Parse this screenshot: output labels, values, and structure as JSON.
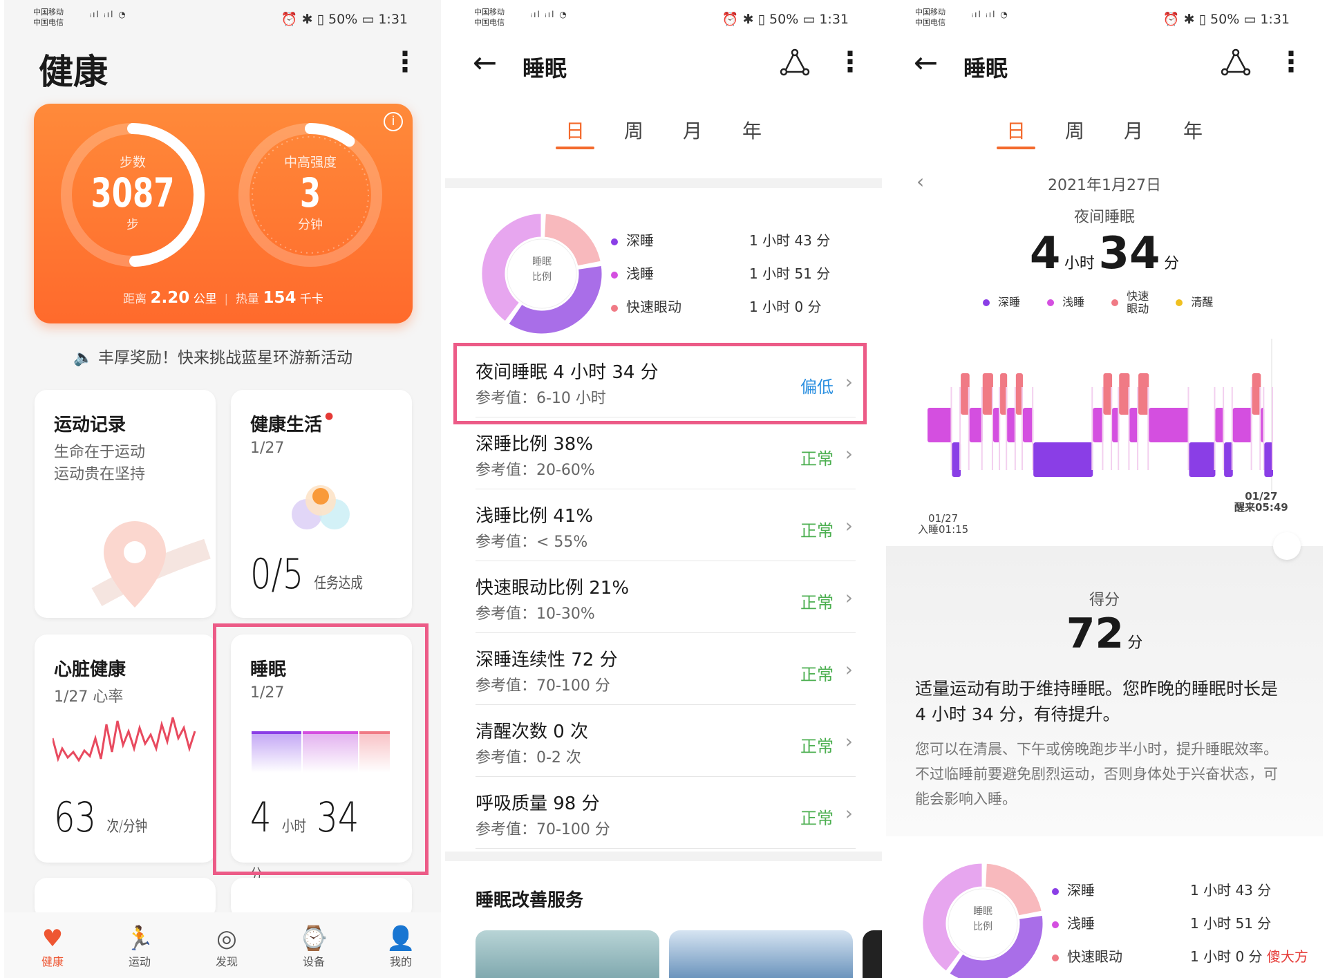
{
  "status": {
    "carrier1": "中国移动",
    "carrier2": "中国电信",
    "battery": "50%",
    "time": "1:31"
  },
  "p1": {
    "title": "健康",
    "steps": {
      "label": "步数",
      "value": "3087",
      "unit": "步",
      "progress": 0.5
    },
    "intensity": {
      "label": "中高强度",
      "value": "3",
      "unit": "分钟",
      "progress": 0.1
    },
    "distance_label": "距离",
    "distance_value": "2.20",
    "distance_unit": "公里",
    "calorie_label": "热量",
    "calorie_value": "154",
    "calorie_unit": "千卡",
    "announcement": "丰厚奖励！快来挑战蓝星环游新活动",
    "exercise": {
      "title": "运动记录",
      "line1": "生命在于运动",
      "line2": "运动贵在坚持"
    },
    "healthy": {
      "title": "健康生活",
      "date": "1/27",
      "value": "0/5",
      "unit": "任务达成"
    },
    "heart": {
      "title": "心脏健康",
      "sub": "1/27 心率",
      "value": "63",
      "unit": "次/分钟"
    },
    "sleep": {
      "title": "睡眠",
      "date": "1/27",
      "h": "4",
      "hu": "小时",
      "m": "34",
      "mu": "分"
    },
    "tabs": [
      "健康",
      "运动",
      "发现",
      "设备",
      "我的"
    ]
  },
  "p2": {
    "title": "睡眠",
    "tabs": [
      "日",
      "周",
      "月",
      "年"
    ],
    "donut_label1": "睡眠",
    "donut_label2": "比例",
    "legend": [
      {
        "name": "深睡",
        "value": "1 小时 43 分"
      },
      {
        "name": "浅睡",
        "value": "1 小时 51 分"
      },
      {
        "name": "快速眼动",
        "value": "1 小时 0 分"
      }
    ],
    "rows": [
      {
        "title": "夜间睡眠  4 小时 34 分",
        "ref": "参考值：6-10 小时",
        "status": "偏低"
      },
      {
        "title": "深睡比例  38%",
        "ref": "参考值：20-60%",
        "status": "正常"
      },
      {
        "title": "浅睡比例  41%",
        "ref": "参考值：< 55%",
        "status": "正常"
      },
      {
        "title": "快速眼动比例  21%",
        "ref": "参考值：10-30%",
        "status": "正常"
      },
      {
        "title": "深睡连续性  72 分",
        "ref": "参考值：70-100 分",
        "status": "正常"
      },
      {
        "title": "清醒次数  0 次",
        "ref": "参考值：0-2 次",
        "status": "正常"
      },
      {
        "title": "呼吸质量  98 分",
        "ref": "参考值：70-100 分",
        "status": "正常"
      }
    ],
    "service_title": "睡眠改善服务"
  },
  "p3": {
    "title": "睡眠",
    "date": "2021年1月27日",
    "night": "夜间睡眠",
    "h": "4",
    "hu": "小时",
    "m": "34",
    "mu": "分",
    "legend": [
      "深睡",
      "浅睡",
      "快速眼动",
      "清醒"
    ],
    "start_date": "01/27",
    "start_label": "入睡01:15",
    "end_date": "01/27",
    "end_label": "醒来05:49",
    "score_label": "得分",
    "score": "72",
    "score_unit": "分",
    "advice_main": "适量运动有助于维持睡眠。您昨晚的睡眠时长是4 小时 34 分，有待提升。",
    "advice_sub": "您可以在清晨、下午或傍晚跑步半小时，提升睡眠效率。不过临睡前要避免剧烈运动，否则身体处于兴奋状态，可能会影响入睡。",
    "legend2": [
      {
        "name": "深睡",
        "value": "1 小时 43 分"
      },
      {
        "name": "浅睡",
        "value": "1 小时 51 分"
      },
      {
        "name": "快速眼动",
        "value": "1 小时 0 分"
      }
    ],
    "watermark": "傻大方"
  },
  "colors": {
    "deep": "#8a3ee6",
    "light": "#d44fe0",
    "rem": "#f07a85",
    "awake": "#f0c020",
    "accent": "#f36a2d",
    "good": "#4caf50",
    "low": "#2a8fe0",
    "highlight": "#ec5b87"
  }
}
